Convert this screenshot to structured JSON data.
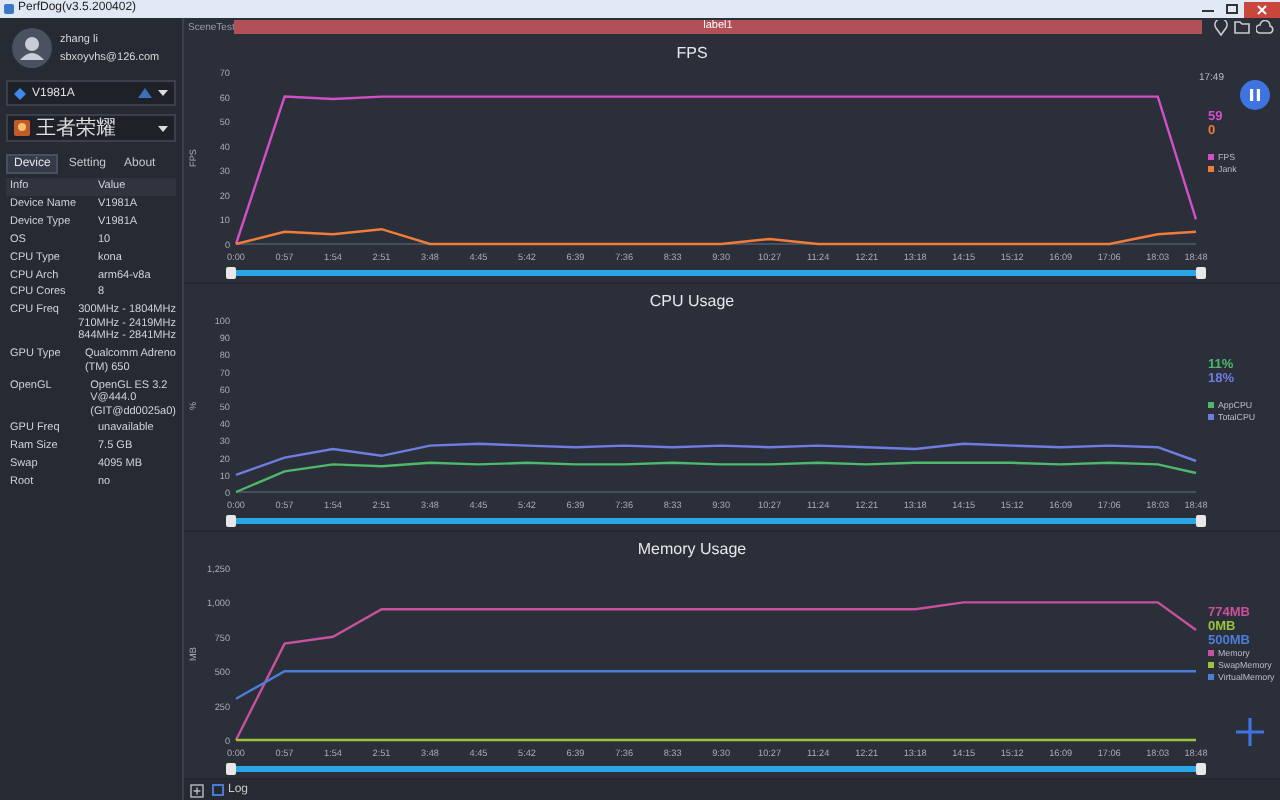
{
  "window": {
    "title": "PerfDog(v3.5.200402)"
  },
  "user": {
    "name": "zhang li",
    "email": "sbxoyvhs@126.com"
  },
  "device_select": {
    "value": "V1981A"
  },
  "app_select": {
    "value": "王者荣耀"
  },
  "tabs": [
    {
      "label": "Device",
      "selected": true
    },
    {
      "label": "Setting",
      "selected": false
    },
    {
      "label": "About",
      "selected": false
    }
  ],
  "info_table": {
    "columns": [
      "Info",
      "Value"
    ],
    "rows": [
      {
        "label": "Device Name",
        "value": [
          "V1981A"
        ]
      },
      {
        "label": "Device Type",
        "value": [
          "V1981A"
        ]
      },
      {
        "label": "OS",
        "value": [
          "10"
        ]
      },
      {
        "label": "CPU Type",
        "value": [
          "kona"
        ]
      },
      {
        "label": "CPU Arch",
        "value": [
          "arm64-v8a"
        ]
      },
      {
        "label": "CPU Cores",
        "value": [
          "8"
        ]
      },
      {
        "label": "CPU Freq",
        "value": [
          "300MHz - 1804MHz",
          "710MHz - 2419MHz",
          "844MHz - 2841MHz"
        ]
      },
      {
        "label": "GPU Type",
        "value": [
          "Qualcomm Adreno",
          "(TM) 650"
        ]
      },
      {
        "label": "OpenGL",
        "value": [
          "OpenGL ES 3.2",
          "V@444.0",
          "(GIT@dd0025a0)"
        ]
      },
      {
        "label": "GPU Freq",
        "value": [
          "unavailable"
        ]
      },
      {
        "label": "Ram Size",
        "value": [
          "7.5 GB"
        ]
      },
      {
        "label": "Swap",
        "value": [
          "4095 MB"
        ]
      },
      {
        "label": "Root",
        "value": [
          "no"
        ]
      }
    ]
  },
  "scene": {
    "label": "SceneTest",
    "bar_label": "label1"
  },
  "time": "17:49",
  "charts": [
    {
      "chart_data": {
        "type": "line",
        "title": "FPS",
        "ylabel": "FPS",
        "legend": "right",
        "xlim": [
          0,
          1128
        ],
        "ylim": [
          0,
          70
        ],
        "yticks": [
          0,
          10,
          20,
          30,
          40,
          50,
          60,
          70
        ],
        "x": [
          0,
          57,
          114,
          171,
          228,
          285,
          342,
          399,
          456,
          513,
          570,
          627,
          684,
          741,
          798,
          855,
          912,
          969,
          1026,
          1083,
          1128
        ],
        "xticks": [
          {
            "value": 0,
            "label": "0:00"
          },
          {
            "value": 57,
            "label": "0:57"
          },
          {
            "value": 114,
            "label": "1:54"
          },
          {
            "value": 171,
            "label": "2:51"
          },
          {
            "value": 228,
            "label": "3:48"
          },
          {
            "value": 285,
            "label": "4:45"
          },
          {
            "value": 342,
            "label": "5:42"
          },
          {
            "value": 399,
            "label": "6:39"
          },
          {
            "value": 456,
            "label": "7:36"
          },
          {
            "value": 513,
            "label": "8:33"
          },
          {
            "value": 570,
            "label": "9:30"
          },
          {
            "value": 627,
            "label": "10:27"
          },
          {
            "value": 684,
            "label": "11:24"
          },
          {
            "value": 741,
            "label": "12:21"
          },
          {
            "value": 798,
            "label": "13:18"
          },
          {
            "value": 855,
            "label": "14:15"
          },
          {
            "value": 912,
            "label": "15:12"
          },
          {
            "value": 969,
            "label": "16:09"
          },
          {
            "value": 1026,
            "label": "17:06"
          },
          {
            "value": 1083,
            "label": "18:03"
          },
          {
            "value": 1128,
            "label": "18:48"
          }
        ],
        "series": [
          {
            "name": "FPS",
            "color": "#d24fc8",
            "values": [
              0,
              60,
              59,
              60,
              60,
              60,
              60,
              60,
              60,
              60,
              60,
              60,
              60,
              60,
              60,
              60,
              60,
              60,
              60,
              60,
              10
            ]
          },
          {
            "name": "Jank",
            "color": "#f07c3a",
            "values": [
              0,
              5,
              4,
              6,
              0,
              0,
              0,
              0,
              0,
              0,
              0,
              2,
              0,
              0,
              0,
              0,
              0,
              0,
              0,
              4,
              5
            ]
          }
        ]
      },
      "readings": [
        {
          "text": "59",
          "color": "#d24fc8"
        },
        {
          "text": "0",
          "color": "#f07c3a"
        }
      ]
    },
    {
      "chart_data": {
        "type": "line",
        "title": "CPU Usage",
        "ylabel": "%",
        "legend": "right",
        "xlim": [
          0,
          1128
        ],
        "ylim": [
          0,
          100
        ],
        "yticks": [
          0,
          10,
          20,
          30,
          40,
          50,
          60,
          70,
          80,
          90,
          100
        ],
        "x": [
          0,
          57,
          114,
          171,
          228,
          285,
          342,
          399,
          456,
          513,
          570,
          627,
          684,
          741,
          798,
          855,
          912,
          969,
          1026,
          1083,
          1128
        ],
        "xticks": [
          {
            "value": 0,
            "label": "0:00"
          },
          {
            "value": 57,
            "label": "0:57"
          },
          {
            "value": 114,
            "label": "1:54"
          },
          {
            "value": 171,
            "label": "2:51"
          },
          {
            "value": 228,
            "label": "3:48"
          },
          {
            "value": 285,
            "label": "4:45"
          },
          {
            "value": 342,
            "label": "5:42"
          },
          {
            "value": 399,
            "label": "6:39"
          },
          {
            "value": 456,
            "label": "7:36"
          },
          {
            "value": 513,
            "label": "8:33"
          },
          {
            "value": 570,
            "label": "9:30"
          },
          {
            "value": 627,
            "label": "10:27"
          },
          {
            "value": 684,
            "label": "11:24"
          },
          {
            "value": 741,
            "label": "12:21"
          },
          {
            "value": 798,
            "label": "13:18"
          },
          {
            "value": 855,
            "label": "14:15"
          },
          {
            "value": 912,
            "label": "15:12"
          },
          {
            "value": 969,
            "label": "16:09"
          },
          {
            "value": 1026,
            "label": "17:06"
          },
          {
            "value": 1083,
            "label": "18:03"
          },
          {
            "value": 1128,
            "label": "18:48"
          }
        ],
        "series": [
          {
            "name": "AppCPU",
            "color": "#4fb86a",
            "values": [
              0,
              12,
              16,
              15,
              17,
              16,
              17,
              16,
              16,
              17,
              16,
              16,
              17,
              16,
              17,
              17,
              17,
              16,
              17,
              16,
              11
            ]
          },
          {
            "name": "TotalCPU",
            "color": "#6f7de0",
            "values": [
              10,
              20,
              25,
              21,
              27,
              28,
              27,
              26,
              27,
              26,
              27,
              26,
              27,
              26,
              25,
              28,
              27,
              26,
              27,
              26,
              18
            ]
          }
        ]
      },
      "readings": [
        {
          "text": "11%",
          "color": "#4fb86a"
        },
        {
          "text": "18%",
          "color": "#6f7de0"
        }
      ]
    },
    {
      "chart_data": {
        "type": "line",
        "title": "Memory Usage",
        "ylabel": "MB",
        "legend": "right",
        "xlim": [
          0,
          1128
        ],
        "ylim": [
          0,
          1250
        ],
        "yticks": [
          0,
          250,
          500,
          750,
          {
            "value": 1000,
            "label": "1,000"
          },
          {
            "value": 1250,
            "label": "1,250"
          }
        ],
        "x": [
          0,
          57,
          114,
          171,
          228,
          285,
          342,
          399,
          456,
          513,
          570,
          627,
          684,
          741,
          798,
          855,
          912,
          969,
          1026,
          1083,
          1128
        ],
        "xticks": [
          {
            "value": 0,
            "label": "0:00"
          },
          {
            "value": 57,
            "label": "0:57"
          },
          {
            "value": 114,
            "label": "1:54"
          },
          {
            "value": 171,
            "label": "2:51"
          },
          {
            "value": 228,
            "label": "3:48"
          },
          {
            "value": 285,
            "label": "4:45"
          },
          {
            "value": 342,
            "label": "5:42"
          },
          {
            "value": 399,
            "label": "6:39"
          },
          {
            "value": 456,
            "label": "7:36"
          },
          {
            "value": 513,
            "label": "8:33"
          },
          {
            "value": 570,
            "label": "9:30"
          },
          {
            "value": 627,
            "label": "10:27"
          },
          {
            "value": 684,
            "label": "11:24"
          },
          {
            "value": 741,
            "label": "12:21"
          },
          {
            "value": 798,
            "label": "13:18"
          },
          {
            "value": 855,
            "label": "14:15"
          },
          {
            "value": 912,
            "label": "15:12"
          },
          {
            "value": 969,
            "label": "16:09"
          },
          {
            "value": 1026,
            "label": "17:06"
          },
          {
            "value": 1083,
            "label": "18:03"
          },
          {
            "value": 1128,
            "label": "18:48"
          }
        ],
        "series": [
          {
            "name": "Memory",
            "color": "#c8509c",
            "values": [
              0,
              700,
              750,
              950,
              950,
              950,
              950,
              950,
              950,
              950,
              950,
              950,
              950,
              950,
              950,
              1000,
              1000,
              1000,
              1000,
              1000,
              800
            ]
          },
          {
            "name": "SwapMemory",
            "color": "#9ac43c",
            "values": [
              0,
              0,
              0,
              0,
              0,
              0,
              0,
              0,
              0,
              0,
              0,
              0,
              0,
              0,
              0,
              0,
              0,
              0,
              0,
              0,
              0
            ]
          },
          {
            "name": "VirtualMemory",
            "color": "#4b7fd6",
            "values": [
              300,
              500,
              500,
              500,
              500,
              500,
              500,
              500,
              500,
              500,
              500,
              500,
              500,
              500,
              500,
              500,
              500,
              500,
              500,
              500,
              500
            ]
          }
        ]
      },
      "readings": [
        {
          "text": "774MB",
          "color": "#c8509c"
        },
        {
          "text": "0MB",
          "color": "#9ac43c"
        },
        {
          "text": "500MB",
          "color": "#4b7fd6"
        }
      ]
    }
  ],
  "log": {
    "label": "Log",
    "checked": false
  }
}
